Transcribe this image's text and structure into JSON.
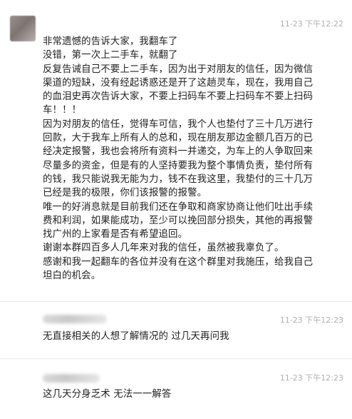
{
  "messages": [
    {
      "time": "11-23 下午12:22",
      "lines": [
        "非常遗憾的告诉大家，我翻车了",
        "没错，第一次上二手车，就翻了",
        "反复告诫自己不要上二手车，因为出于对朋友的信任，因为微信",
        "渠道的短缺，没有经起诱惑还是开了这趟灵车，现在，我用自己",
        "的血泪史再次告诉大家，不要上扫码车不要上扫码车不要上扫码",
        "车！！！",
        "因为对朋友的信任，觉得车可信，我个人也垫付了三十几万进行",
        "回款，大于我车上所有人的总和，现在朋友那边金额几百万的已",
        "经决定报警，我也会将所有资料一并递交，为车上的人争取回来",
        "尽量多的资金，但是有的人坚持要我为整个事情负责，垫付所有",
        "的钱，我只能说我无能为力，钱不在我这里，我垫付的三十几万",
        "已经是我的极限，你们该报警的报警。",
        "唯一的好消息就是目前我们还在争取和商家协商让他们吐出手续",
        "费和利润，如果能成功，至少可以挽回部分损失，其他的再报警",
        "找广州的上家看是否有希望追回。",
        "谢谢本群四百多人几年来对我的信任，虽然被我辜负了。",
        "感谢和我一起翻车的各位并没有在这个群里对我施压，给我自己",
        "坦白的机会。"
      ]
    },
    {
      "time": "11-23 下午12:23",
      "lines": [
        "无直接相关的人想了解情况的 过几天再问我"
      ]
    },
    {
      "time": "11-23 下午12:23",
      "lines": [
        "这几天分身乏术 无法一一解答"
      ]
    }
  ]
}
